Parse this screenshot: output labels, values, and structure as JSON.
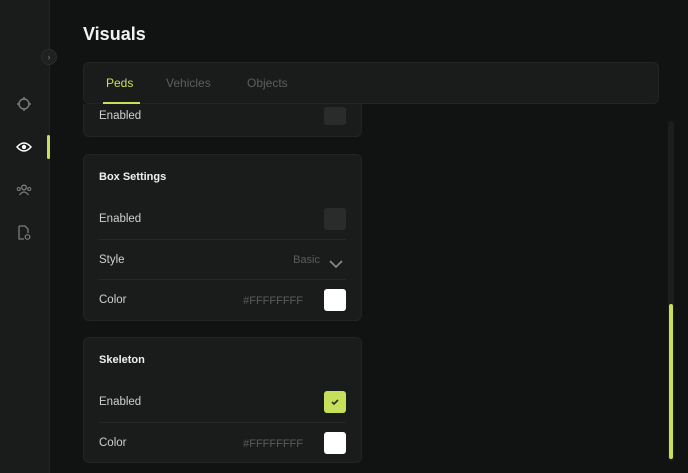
{
  "header": {
    "title": "Visuals"
  },
  "tabs": [
    {
      "label": "Peds",
      "active": true
    },
    {
      "label": "Vehicles",
      "active": false
    },
    {
      "label": "Objects",
      "active": false
    }
  ],
  "sidebar": {
    "items": [
      {
        "icon": "crosshair-icon",
        "active": false
      },
      {
        "icon": "eye-icon",
        "active": true
      },
      {
        "icon": "players-icon",
        "active": false
      },
      {
        "icon": "file-settings-icon",
        "active": false
      }
    ]
  },
  "cards": {
    "partial": {
      "label": "Enabled"
    },
    "box_settings": {
      "title": "Box Settings",
      "enabled_label": "Enabled",
      "enabled": false,
      "style_label": "Style",
      "style_value": "Basic",
      "color_label": "Color",
      "color_value": "#FFFFFFFF"
    },
    "skeleton": {
      "title": "Skeleton",
      "enabled_label": "Enabled",
      "enabled": true,
      "color_label": "Color",
      "color_value": "#FFFFFFFF"
    }
  },
  "colors": {
    "accent": "#c6e05b",
    "background": "#111212",
    "panel": "#1a1b1b"
  },
  "scroll": {
    "position": 0.55
  }
}
